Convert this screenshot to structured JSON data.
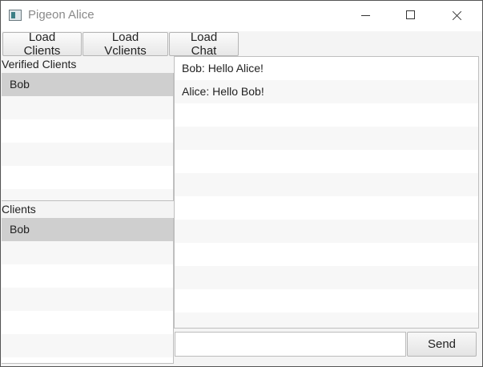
{
  "window": {
    "title": "Pigeon Alice",
    "icon": "app-window-icon",
    "controls": [
      "minimize-icon",
      "maximize-icon",
      "close-icon"
    ]
  },
  "toolbar": {
    "load_clients_label": "Load Clients",
    "load_vclients_label": "Load Vclients",
    "load_chat_label": "Load Chat"
  },
  "sidebar": {
    "verified_label": "Verified Clients",
    "verified_items": [
      {
        "label": "Bob",
        "selected": true
      }
    ],
    "clients_label": "Clients",
    "clients_items": [
      {
        "label": "Bob",
        "selected": true
      }
    ]
  },
  "chat": {
    "messages": [
      "Bob: Hello Alice!",
      "Alice: Hello Bob!"
    ]
  },
  "composer": {
    "input_value": "",
    "send_label": "Send"
  },
  "colors": {
    "selection": "#cfcfcf",
    "stripe": "#f7f7f7",
    "border": "#bfbfbf"
  }
}
